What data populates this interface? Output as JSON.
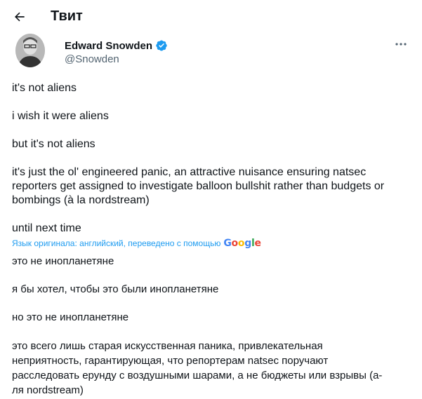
{
  "header": {
    "title": "Твит"
  },
  "author": {
    "name": "Edward Snowden",
    "handle": "@Snowden"
  },
  "tweet": {
    "line1": "it's not aliens",
    "line2": "i wish it were aliens",
    "line3": "but it's not aliens",
    "line4": "it's just the ol' engineered panic, an attractive nuisance ensuring natsec reporters get assigned to investigate balloon bullshit rather than budgets or bombings (à la nordstream)",
    "line5": "until next time"
  },
  "translation": {
    "note": "Язык оригинала: английский, переведено с помощью",
    "provider": "Google",
    "line1": "это не инопланетяне",
    "line2": "я бы хотел, чтобы это были инопланетяне",
    "line3": "но это не инопланетяне",
    "line4": "это всего лишь старая искусственная паника, привлекательная неприятность, гарантирующая, что репортерам natsec поручают расследовать ерунду с воздушными шарами, а не бюджеты или взрывы (а-ля nordstream)"
  },
  "colors": {
    "link": "#1d9bf0",
    "muted": "#536471",
    "text": "#0f1419"
  },
  "icons": {
    "back": "arrow-left-icon",
    "verified": "verified-badge-icon",
    "more": "more-horizontal-icon"
  }
}
